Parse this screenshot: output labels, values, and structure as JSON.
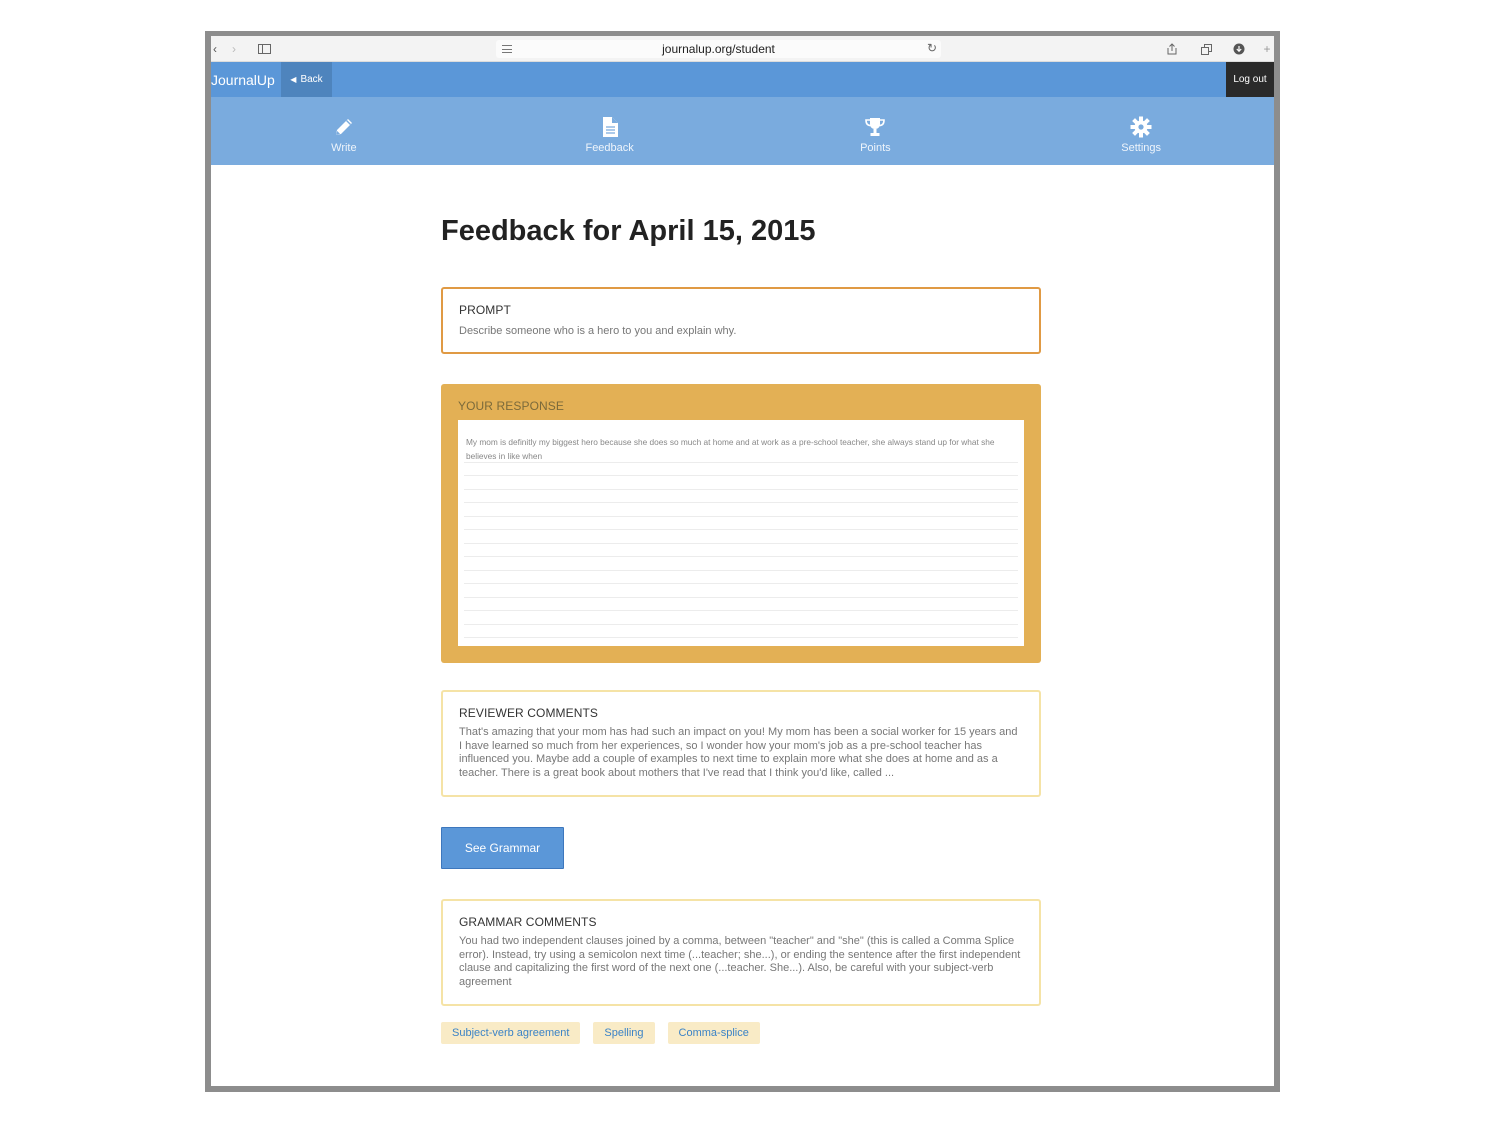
{
  "browser": {
    "url": "journalup.org/student"
  },
  "topbar": {
    "brand": "JournalUp",
    "back_label": "Back",
    "logout_label": "Log out"
  },
  "tabs": [
    {
      "label": "Write",
      "icon": "pencil-icon"
    },
    {
      "label": "Feedback",
      "icon": "document-icon"
    },
    {
      "label": "Points",
      "icon": "trophy-icon"
    },
    {
      "label": "Settings",
      "icon": "gear-icon"
    }
  ],
  "page": {
    "title": "Feedback for April 15, 2015"
  },
  "prompt": {
    "heading": "PROMPT",
    "text": "Describe someone who is a hero to you and explain why."
  },
  "response": {
    "heading": "YOUR RESPONSE",
    "text": "My mom is definitly my biggest hero because she does so much at home and at work as a pre-school teacher, she always stand up for what she believes in like when"
  },
  "reviewer": {
    "heading": "REVIEWER COMMENTS",
    "text": "That's amazing that your mom has had such an impact on you! My mom has been a social worker for 15 years and I have learned so much from her experiences, so I wonder how your mom's job as a pre-school teacher has influenced you. Maybe add a couple of examples to next time to explain more what she does at home and as a teacher. There is a great book about mothers that I've read that I think you'd like, called ..."
  },
  "grammar_button": {
    "label": "See Grammar"
  },
  "grammar": {
    "heading": "GRAMMAR COMMENTS",
    "text": "You had two independent clauses joined by a comma, between \"teacher\" and \"she\" (this is called a Comma Splice error). Instead, try using a semicolon next time (...teacher; she...), or ending the sentence after the first independent clause and capitalizing the first word of the next one (...teacher. She...). Also, be careful with your subject-verb agreement"
  },
  "tags": [
    "Subject-verb agreement",
    "Spelling",
    "Comma-splice"
  ],
  "colors": {
    "topbar": "#5b97d8",
    "tabbar": "#7aabde",
    "prompt_border": "#e09a44",
    "response_bg": "#e3b055",
    "comment_border": "#f5e3a6",
    "tag_bg": "#f9ebc6"
  }
}
